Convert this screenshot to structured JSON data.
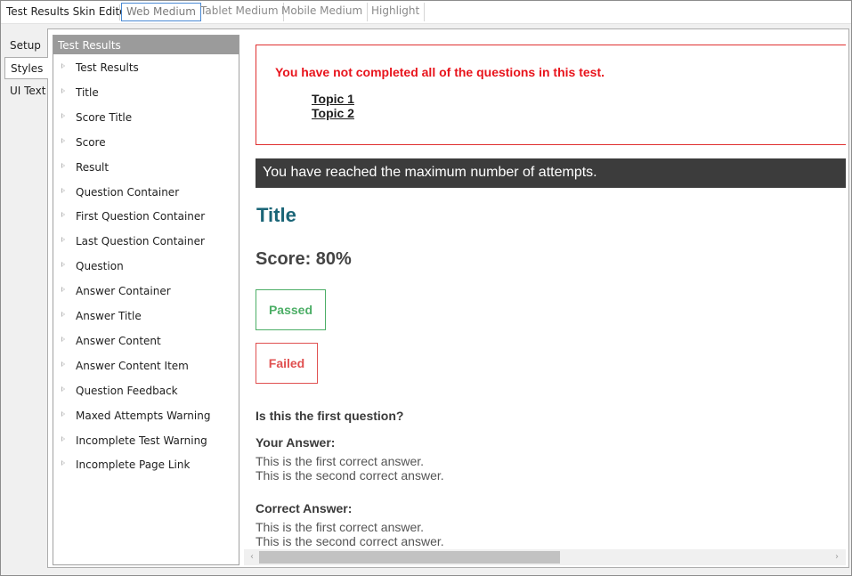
{
  "app": {
    "title": "Test Results Skin Editor"
  },
  "mode_tabs": [
    {
      "label": "Web Medium",
      "active": true
    },
    {
      "label": "Tablet Medium",
      "active": false
    },
    {
      "label": "Mobile Medium",
      "active": false
    },
    {
      "label": "Highlight",
      "active": false
    }
  ],
  "side_tabs": [
    {
      "label": "Setup",
      "active": false
    },
    {
      "label": "Styles",
      "active": true
    },
    {
      "label": "UI Text",
      "active": false
    }
  ],
  "tree": {
    "header": "Test Results",
    "items": [
      "Test Results",
      "Title",
      "Score Title",
      "Score",
      "Result",
      "Question Container",
      "First Question Container",
      "Last Question Container",
      "Question",
      "Answer Container",
      "Answer Title",
      "Answer Content",
      "Answer Content Item",
      "Question Feedback",
      "Maxed Attempts Warning",
      "Incomplete Test Warning",
      "Incomplete Page Link"
    ]
  },
  "preview": {
    "incomplete_message": "You have not completed all of the questions in this test.",
    "topics": [
      "Topic 1",
      "Topic 2"
    ],
    "max_attempts_message": "You have reached the maximum number of attempts.",
    "title": "Title",
    "score": "Score: 80%",
    "passed": "Passed",
    "failed": "Failed",
    "question": "Is this the first question?",
    "your_answer_label": "Your Answer:",
    "your_answers": [
      "This is the first correct answer.",
      "This is the second correct answer."
    ],
    "correct_answer_label": "Correct Answer:",
    "correct_answers": [
      "This is the first correct answer.",
      "This is the second correct answer."
    ]
  },
  "colors": {
    "incomplete_text": "#e8141c",
    "title": "#1a6577",
    "passed": "#4cae66",
    "failed": "#e05050",
    "attempts_bar": "#3c3c3c",
    "tab_focus": "#4a8ad4"
  },
  "icons": {
    "tree_caret": "triangle-right-icon",
    "scroll_left": "chevron-left-icon",
    "scroll_right": "chevron-right-icon"
  }
}
